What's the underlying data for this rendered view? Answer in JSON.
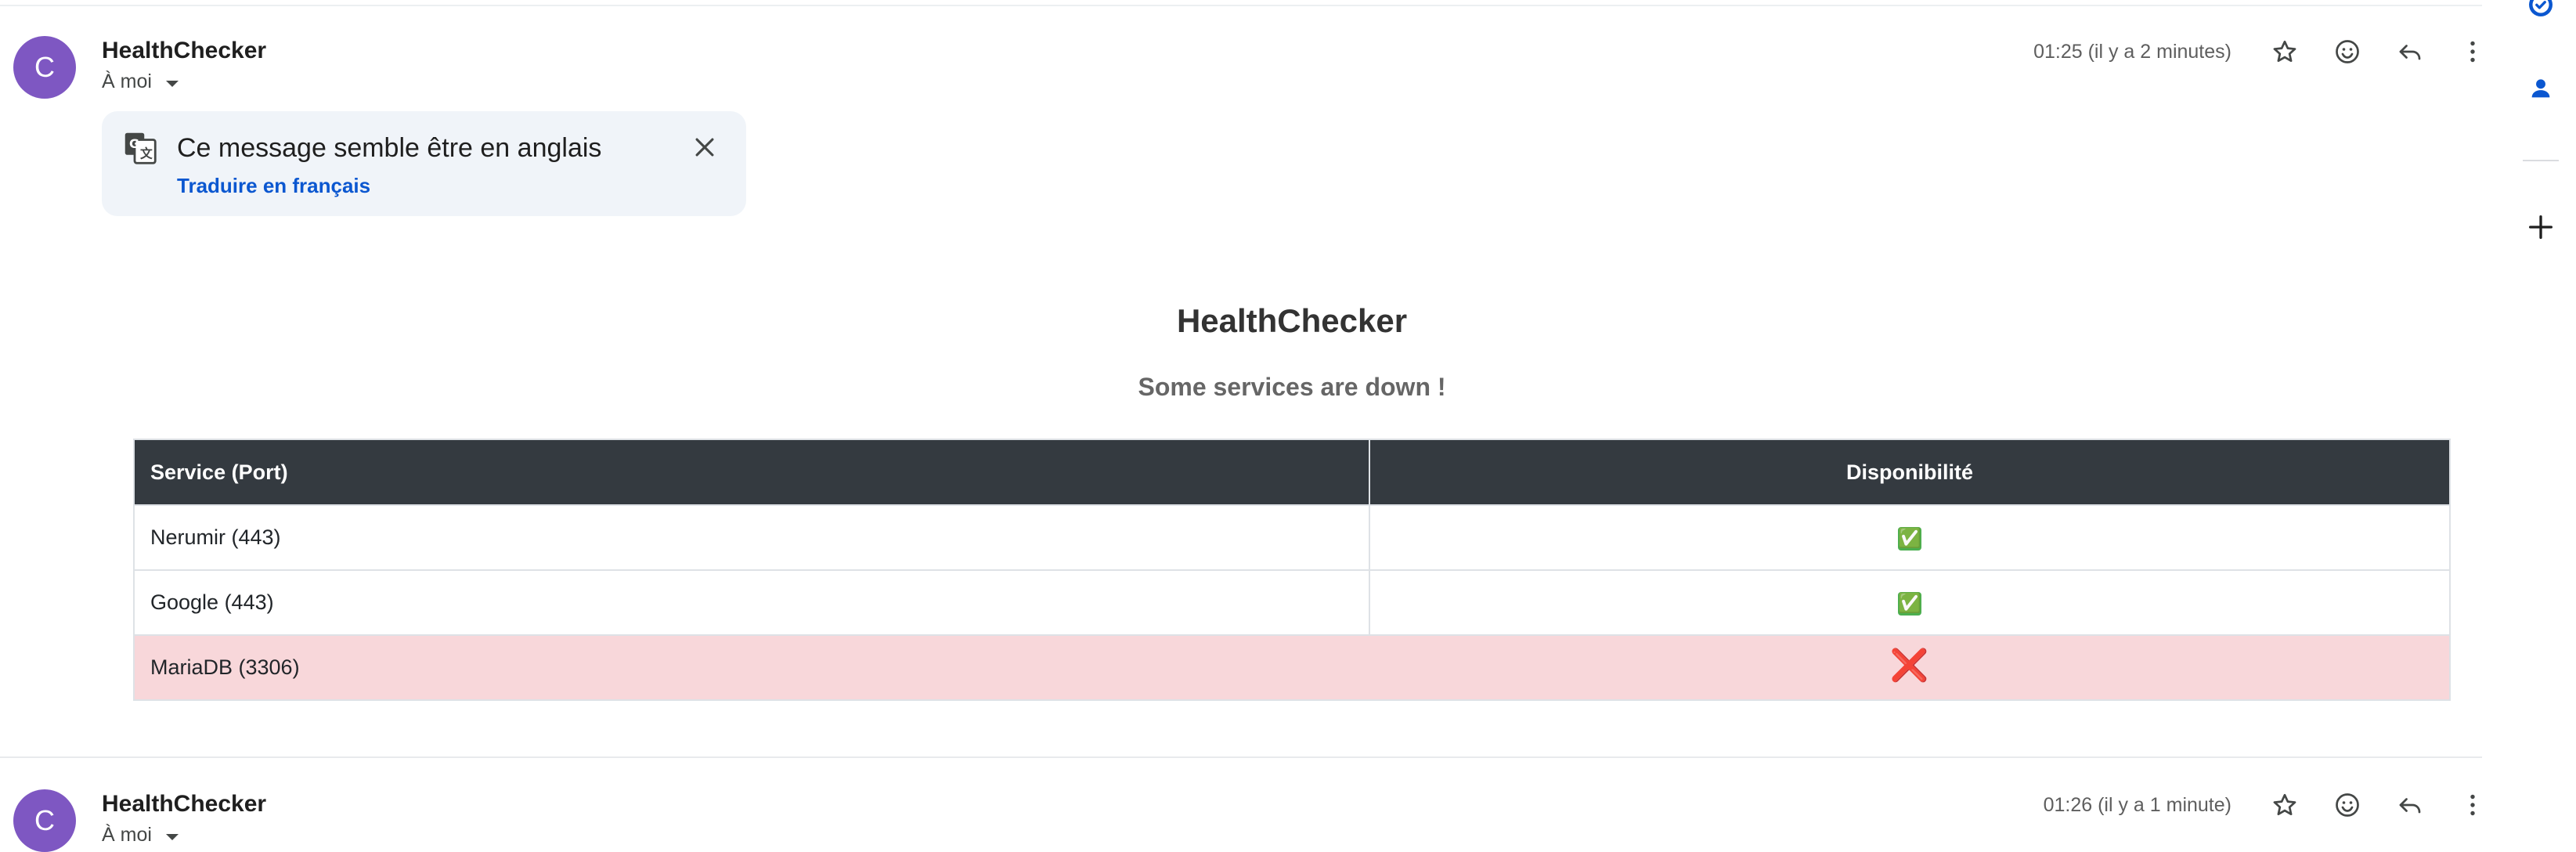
{
  "thread": {
    "messages": [
      {
        "avatar_letter": "C",
        "sender": "HealthChecker",
        "recipient": "À moi",
        "time": "01:25 (il y a 2 minutes)"
      },
      {
        "avatar_letter": "C",
        "sender": "HealthChecker",
        "recipient": "À moi",
        "time": "01:26 (il y a 1 minute)"
      }
    ]
  },
  "translation": {
    "title": "Ce message semble être en anglais",
    "link": "Traduire en français"
  },
  "email": {
    "title": "HealthChecker",
    "subtitle": "Some services are down !",
    "table": {
      "headers": [
        "Service (Port)",
        "Disponibilité"
      ],
      "rows": [
        {
          "service": "Nerumir (443)",
          "status": "✅",
          "state": "up"
        },
        {
          "service": "Google (443)",
          "status": "✅",
          "state": "up"
        },
        {
          "service": "MariaDB (3306)",
          "status": "❌",
          "state": "down"
        }
      ]
    }
  },
  "colors": {
    "avatar": "#7e57c2",
    "header_bg": "#343a40",
    "down_row_bg": "#f8d7da",
    "link": "#0b57d0"
  },
  "icons": {
    "star": "star-icon",
    "emoji": "emoji-icon",
    "reply": "reply-icon",
    "more": "more-vert-icon",
    "translate": "translate-icon",
    "close": "close-icon",
    "tasks": "tasks-icon",
    "contacts": "contacts-icon",
    "add": "add-icon"
  }
}
